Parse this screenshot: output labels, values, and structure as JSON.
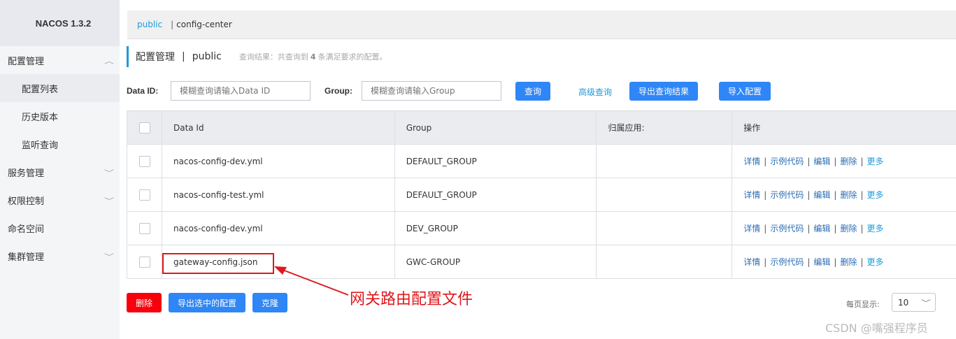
{
  "app": {
    "logo": "NACOS 1.3.2"
  },
  "sidebar": {
    "items": [
      {
        "label": "配置管理",
        "chevron": "up"
      },
      {
        "label": "配置列表",
        "sub": true,
        "active": true
      },
      {
        "label": "历史版本",
        "sub": true
      },
      {
        "label": "监听查询",
        "sub": true
      },
      {
        "label": "服务管理",
        "chevron": "down"
      },
      {
        "label": "权限控制",
        "chevron": "down"
      },
      {
        "label": "命名空间"
      },
      {
        "label": "集群管理",
        "chevron": "down"
      }
    ]
  },
  "breadcrumb": {
    "namespace": "public",
    "separator": "|",
    "current": "config-center"
  },
  "header": {
    "title": "配置管理",
    "separator": "|",
    "namespace": "public",
    "result_prefix": "查询结果：共查询到",
    "result_count": "4",
    "result_suffix": "条满足要求的配置。"
  },
  "search": {
    "dataid_label": "Data ID:",
    "dataid_placeholder": "模糊查询请输入Data ID",
    "group_label": "Group:",
    "group_placeholder": "模糊查询请输入Group",
    "query_button": "查询",
    "advanced_link": "高级查询",
    "export_button": "导出查询结果",
    "import_button": "导入配置"
  },
  "table": {
    "columns": [
      "Data Id",
      "Group",
      "归属应用:",
      "操作"
    ],
    "rows": [
      {
        "data_id": "nacos-config-dev.yml",
        "group": "DEFAULT_GROUP",
        "app": ""
      },
      {
        "data_id": "nacos-config-test.yml",
        "group": "DEFAULT_GROUP",
        "app": ""
      },
      {
        "data_id": "nacos-config-dev.yml",
        "group": "DEV_GROUP",
        "app": ""
      },
      {
        "data_id": "gateway-config.json",
        "group": "GWC-GROUP",
        "app": ""
      }
    ],
    "ops": {
      "detail": "详情",
      "sample": "示例代码",
      "edit": "编辑",
      "delete": "删除",
      "more": "更多",
      "sep": "|"
    }
  },
  "bottom": {
    "delete_button": "删除",
    "export_selected_button": "导出选中的配置",
    "clone_button": "克隆",
    "page_size_label": "每页显示:",
    "page_size_value": "10"
  },
  "annotation": {
    "text": "网关路由配置文件"
  },
  "watermark": "CSDN @嘴强程序员",
  "colors": {
    "primary": "#2f86f6",
    "danger": "#f7000b",
    "link": "#1d9bd9",
    "annotation": "#e0171c"
  }
}
